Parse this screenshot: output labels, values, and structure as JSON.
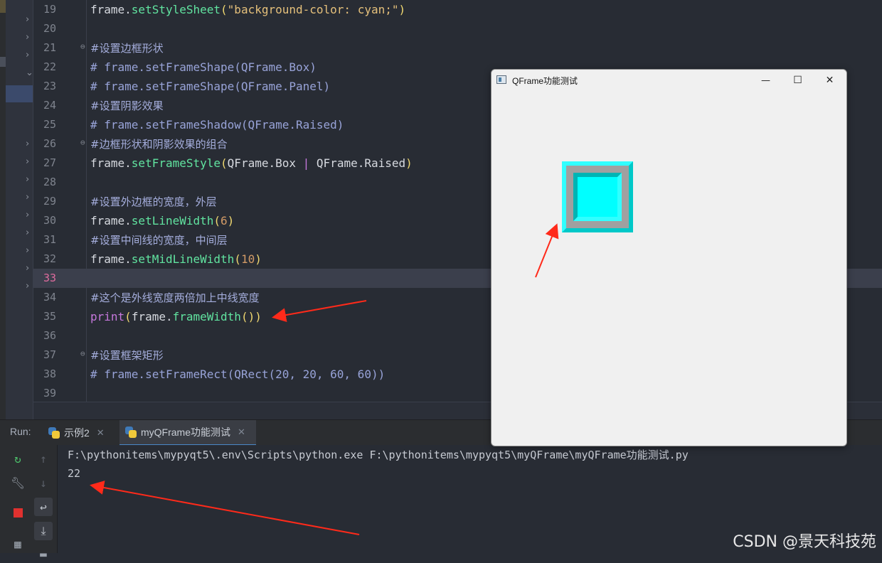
{
  "editor": {
    "lines": [
      {
        "num": "19",
        "segments": [
          [
            "frame.",
            "c-plain"
          ],
          [
            "setStyleSheet",
            "c-fn"
          ],
          [
            "(",
            "c-paren"
          ],
          [
            "\"background-color: cyan;\"",
            "c-str"
          ],
          [
            ")",
            "c-paren"
          ]
        ]
      },
      {
        "num": "20",
        "segments": []
      },
      {
        "num": "21",
        "fold": true,
        "segments": [
          [
            "#设置边框形状",
            "c-comment-cn"
          ]
        ]
      },
      {
        "num": "22",
        "segments": [
          [
            "# frame.setFrameShape(QFrame.Box)",
            "c-comment"
          ]
        ]
      },
      {
        "num": "23",
        "segments": [
          [
            "# frame.setFrameShape(QFrame.Panel)",
            "c-comment"
          ]
        ]
      },
      {
        "num": "24",
        "segments": [
          [
            "#设置阴影效果",
            "c-comment-cn"
          ]
        ]
      },
      {
        "num": "25",
        "segments": [
          [
            "# frame.setFrameShadow(QFrame.Raised)",
            "c-comment"
          ]
        ]
      },
      {
        "num": "26",
        "fold": true,
        "segments": [
          [
            "#边框形状和阴影效果的组合",
            "c-comment-cn"
          ]
        ]
      },
      {
        "num": "27",
        "segments": [
          [
            "frame.",
            "c-plain"
          ],
          [
            "setFrameStyle",
            "c-fn"
          ],
          [
            "(",
            "c-paren"
          ],
          [
            "QFrame.Box ",
            "c-plain"
          ],
          [
            "|",
            "c-kw"
          ],
          [
            " QFrame.Raised",
            "c-plain"
          ],
          [
            ")",
            "c-paren"
          ]
        ]
      },
      {
        "num": "28",
        "segments": []
      },
      {
        "num": "29",
        "segments": [
          [
            "#设置外边框的宽度，外层",
            "c-comment-cn"
          ]
        ]
      },
      {
        "num": "30",
        "segments": [
          [
            "frame.",
            "c-plain"
          ],
          [
            "setLineWidth",
            "c-fn"
          ],
          [
            "(",
            "c-paren"
          ],
          [
            "6",
            "c-num"
          ],
          [
            ")",
            "c-paren"
          ]
        ]
      },
      {
        "num": "31",
        "segments": [
          [
            "#设置中间线的宽度，中间层",
            "c-comment-cn"
          ]
        ]
      },
      {
        "num": "32",
        "segments": [
          [
            "frame.",
            "c-plain"
          ],
          [
            "setMidLineWidth",
            "c-fn"
          ],
          [
            "(",
            "c-paren"
          ],
          [
            "10",
            "c-num"
          ],
          [
            ")",
            "c-paren"
          ]
        ]
      },
      {
        "num": "33",
        "current": true,
        "segments": []
      },
      {
        "num": "34",
        "segments": [
          [
            "#这个是外线宽度两倍加上中线宽度",
            "c-comment-cn"
          ]
        ]
      },
      {
        "num": "35",
        "segments": [
          [
            "print",
            "c-kw"
          ],
          [
            "(",
            "c-paren"
          ],
          [
            "frame.",
            "c-plain"
          ],
          [
            "frameWidth",
            "c-fn"
          ],
          [
            "())",
            "c-paren"
          ]
        ]
      },
      {
        "num": "36",
        "segments": []
      },
      {
        "num": "37",
        "fold": true,
        "segments": [
          [
            "#设置框架矩形",
            "c-comment-cn"
          ]
        ]
      },
      {
        "num": "38",
        "segments": [
          [
            "# frame.setFrameRect(QRect(20, 20, 60, 60))",
            "c-comment"
          ]
        ]
      },
      {
        "num": "39",
        "segments": []
      }
    ]
  },
  "run": {
    "label": "Run:",
    "tabs": [
      {
        "label": "示例2",
        "active": false
      },
      {
        "label": "myQFrame功能测试",
        "active": true
      }
    ],
    "output": [
      "F:\\pythonitems\\mypyqt5\\.env\\Scripts\\python.exe F:\\pythonitems\\mypyqt5\\myQFrame\\myQFrame功能测试.py",
      "22"
    ]
  },
  "qframe_window": {
    "title": "QFrame功能测试",
    "minimize": "—",
    "maximize": "☐",
    "close": "✕",
    "frame_background": "#00ffff"
  },
  "watermark": "CSDN @景天科技苑",
  "colors": {
    "arrow": "#ff2a1a",
    "accent_tab": "#4a88c7"
  }
}
